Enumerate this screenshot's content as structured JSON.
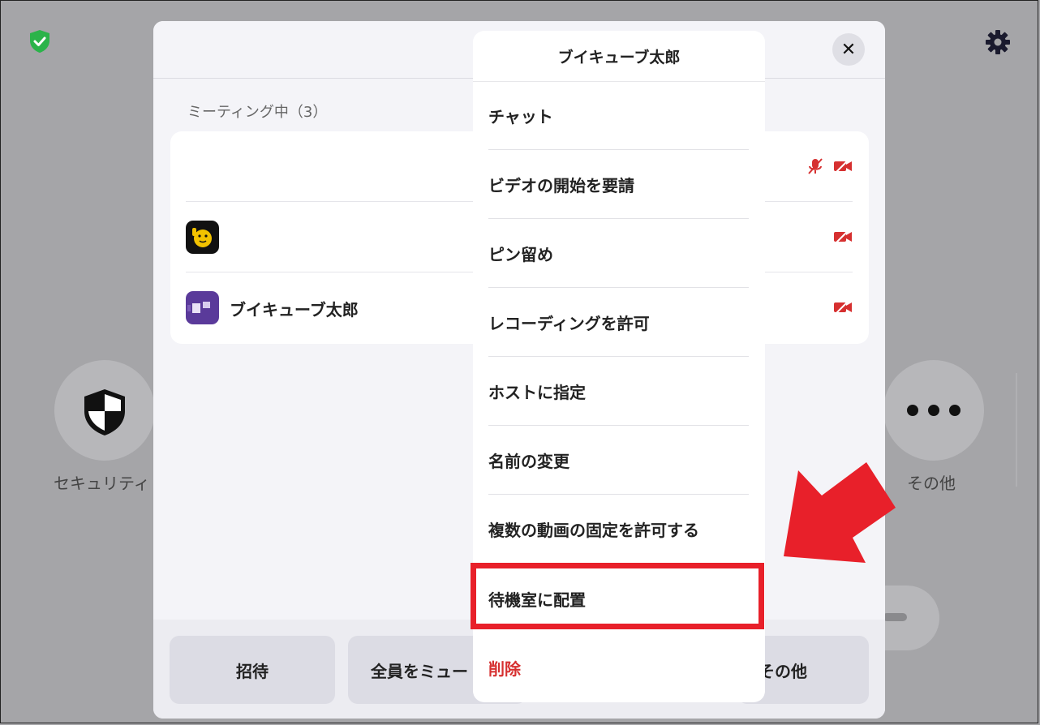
{
  "background": {
    "security_label": "セキュリティ",
    "more_label": "その他"
  },
  "panel": {
    "section_title": "ミーティング中（3）",
    "participants": [
      {
        "name": "",
        "muted": true,
        "video_off": true
      },
      {
        "name": "",
        "muted": false,
        "video_off": true
      },
      {
        "name": "ブイキューブ太郎",
        "muted": false,
        "video_off": true
      }
    ],
    "buttons": {
      "invite": "招待",
      "mute_all": "全員をミュー",
      "more": "その他"
    }
  },
  "menu": {
    "title": "ブイキューブ太郎",
    "items": [
      "チャット",
      "ビデオの開始を要請",
      "ピン留め",
      "レコーディングを許可",
      "ホストに指定",
      "名前の変更",
      "複数の動画の固定を許可する",
      "待機室に配置",
      "削除"
    ]
  },
  "colors": {
    "accent_red": "#e8202a",
    "danger_text": "#d63030",
    "shield_green": "#2bb34a"
  }
}
